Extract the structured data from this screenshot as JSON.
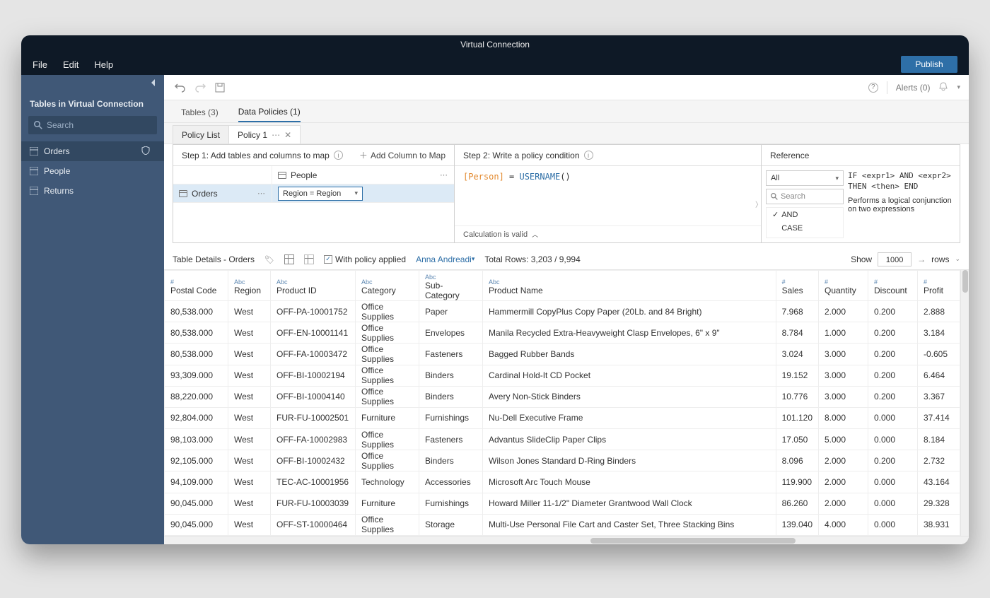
{
  "window": {
    "title": "Virtual Connection"
  },
  "menubar": {
    "items": [
      "File",
      "Edit",
      "Help"
    ],
    "publish": "Publish"
  },
  "toolbar_right": {
    "alerts": "Alerts (0)"
  },
  "sidebar": {
    "title": "Tables in Virtual Connection",
    "search_placeholder": "Search",
    "items": [
      {
        "label": "Orders",
        "selected": true,
        "badge": true
      },
      {
        "label": "People",
        "selected": false,
        "badge": false
      },
      {
        "label": "Returns",
        "selected": false,
        "badge": false
      }
    ]
  },
  "tabs1": [
    {
      "label": "Tables (3)",
      "active": false
    },
    {
      "label": "Data Policies (1)",
      "active": true
    }
  ],
  "tabs2": [
    {
      "label": "Policy List",
      "active": false,
      "closable": false
    },
    {
      "label": "Policy 1",
      "active": true,
      "closable": true
    }
  ],
  "step1": {
    "title": "Step 1: Add tables and columns to map",
    "add_col": "Add Column to Map",
    "rows": [
      {
        "left": "",
        "right": "People"
      },
      {
        "left": "Orders",
        "right_dd": "Region = Region",
        "selected": true
      }
    ]
  },
  "step2": {
    "title": "Step 2: Write a policy condition",
    "expr_field": "[Person]",
    "expr_eq": " = ",
    "expr_func": "USERNAME",
    "expr_paren": "()",
    "footer": "Calculation is valid"
  },
  "reference": {
    "title": "Reference",
    "filter": "All",
    "search": "Search",
    "items": [
      {
        "label": "AND",
        "checked": true
      },
      {
        "label": "CASE",
        "checked": false
      }
    ],
    "code": "IF <expr1> AND <expr2> THEN <then> END",
    "desc": "Performs a logical conjunction on two expressions"
  },
  "details": {
    "title": "Table Details - Orders",
    "policy_chk": "With policy applied",
    "user": "Anna Andreadi",
    "total_rows": "Total Rows: 3,203 / 9,994",
    "show": "Show",
    "show_n": "1000",
    "rows_label": "rows"
  },
  "columns": [
    {
      "type": "#",
      "label": "Postal Code"
    },
    {
      "type": "Abc",
      "label": "Region"
    },
    {
      "type": "Abc",
      "label": "Product ID"
    },
    {
      "type": "Abc",
      "label": "Category"
    },
    {
      "type": "Abc",
      "label": "Sub-Category"
    },
    {
      "type": "Abc",
      "label": "Product Name"
    },
    {
      "type": "#",
      "label": "Sales"
    },
    {
      "type": "#",
      "label": "Quantity"
    },
    {
      "type": "#",
      "label": "Discount"
    },
    {
      "type": "#",
      "label": "Profit"
    }
  ],
  "rows": [
    [
      "80,538.000",
      "West",
      "OFF-PA-10001752",
      "Office Supplies",
      "Paper",
      "Hammermill CopyPlus Copy Paper (20Lb. and 84 Bright)",
      "7.968",
      "2.000",
      "0.200",
      "2.888"
    ],
    [
      "80,538.000",
      "West",
      "OFF-EN-10001141",
      "Office Supplies",
      "Envelopes",
      "Manila Recycled Extra-Heavyweight Clasp Envelopes, 6\" x 9\"",
      "8.784",
      "1.000",
      "0.200",
      "3.184"
    ],
    [
      "80,538.000",
      "West",
      "OFF-FA-10003472",
      "Office Supplies",
      "Fasteners",
      "Bagged Rubber Bands",
      "3.024",
      "3.000",
      "0.200",
      "-0.605"
    ],
    [
      "93,309.000",
      "West",
      "OFF-BI-10002194",
      "Office Supplies",
      "Binders",
      "Cardinal Hold-It CD Pocket",
      "19.152",
      "3.000",
      "0.200",
      "6.464"
    ],
    [
      "88,220.000",
      "West",
      "OFF-BI-10004140",
      "Office Supplies",
      "Binders",
      "Avery Non-Stick Binders",
      "10.776",
      "3.000",
      "0.200",
      "3.367"
    ],
    [
      "92,804.000",
      "West",
      "FUR-FU-10002501",
      "Furniture",
      "Furnishings",
      "Nu-Dell Executive Frame",
      "101.120",
      "8.000",
      "0.000",
      "37.414"
    ],
    [
      "98,103.000",
      "West",
      "OFF-FA-10002983",
      "Office Supplies",
      "Fasteners",
      "Advantus SlideClip Paper Clips",
      "17.050",
      "5.000",
      "0.000",
      "8.184"
    ],
    [
      "92,105.000",
      "West",
      "OFF-BI-10002432",
      "Office Supplies",
      "Binders",
      "Wilson Jones Standard D-Ring Binders",
      "8.096",
      "2.000",
      "0.200",
      "2.732"
    ],
    [
      "94,109.000",
      "West",
      "TEC-AC-10001956",
      "Technology",
      "Accessories",
      "Microsoft Arc Touch Mouse",
      "119.900",
      "2.000",
      "0.000",
      "43.164"
    ],
    [
      "90,045.000",
      "West",
      "FUR-FU-10003039",
      "Furniture",
      "Furnishings",
      "Howard Miller 11-1/2\" Diameter Grantwood Wall Clock",
      "86.260",
      "2.000",
      "0.000",
      "29.328"
    ],
    [
      "90,045.000",
      "West",
      "OFF-ST-10000464",
      "Office Supplies",
      "Storage",
      "Multi-Use Personal File Cart and Caster Set, Three Stacking Bins",
      "139.040",
      "4.000",
      "0.000",
      "38.931"
    ]
  ]
}
